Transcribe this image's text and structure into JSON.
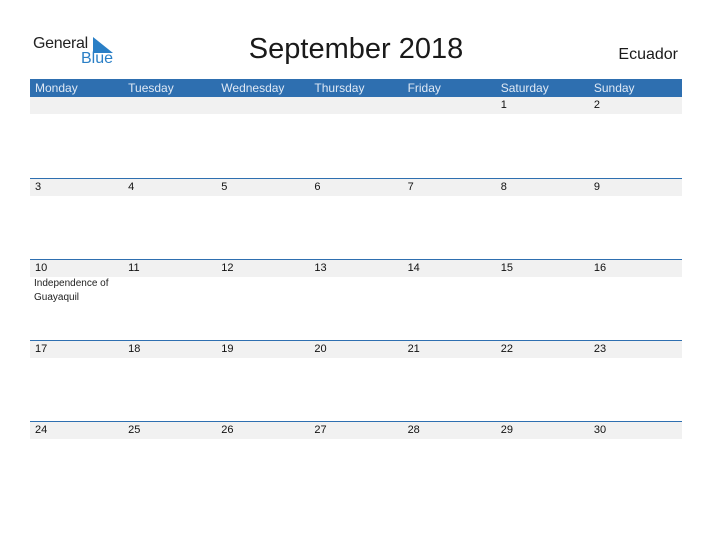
{
  "logo": {
    "general": "General",
    "blue": "Blue",
    "accent_color": "#2a7fc6"
  },
  "title": "September 2018",
  "country": "Ecuador",
  "colors": {
    "header_bg": "#2e6fb0",
    "date_bg": "#f1f1f1"
  },
  "weekdays": [
    "Monday",
    "Tuesday",
    "Wednesday",
    "Thursday",
    "Friday",
    "Saturday",
    "Sunday"
  ],
  "weeks": [
    [
      {
        "d": ""
      },
      {
        "d": ""
      },
      {
        "d": ""
      },
      {
        "d": ""
      },
      {
        "d": ""
      },
      {
        "d": "1"
      },
      {
        "d": "2"
      }
    ],
    [
      {
        "d": "3"
      },
      {
        "d": "4"
      },
      {
        "d": "5"
      },
      {
        "d": "6"
      },
      {
        "d": "7"
      },
      {
        "d": "8"
      },
      {
        "d": "9"
      }
    ],
    [
      {
        "d": "10",
        "h": "Independence of Guayaquil"
      },
      {
        "d": "11"
      },
      {
        "d": "12"
      },
      {
        "d": "13"
      },
      {
        "d": "14"
      },
      {
        "d": "15"
      },
      {
        "d": "16"
      }
    ],
    [
      {
        "d": "17"
      },
      {
        "d": "18"
      },
      {
        "d": "19"
      },
      {
        "d": "20"
      },
      {
        "d": "21"
      },
      {
        "d": "22"
      },
      {
        "d": "23"
      }
    ],
    [
      {
        "d": "24"
      },
      {
        "d": "25"
      },
      {
        "d": "26"
      },
      {
        "d": "27"
      },
      {
        "d": "28"
      },
      {
        "d": "29"
      },
      {
        "d": "30"
      }
    ]
  ]
}
